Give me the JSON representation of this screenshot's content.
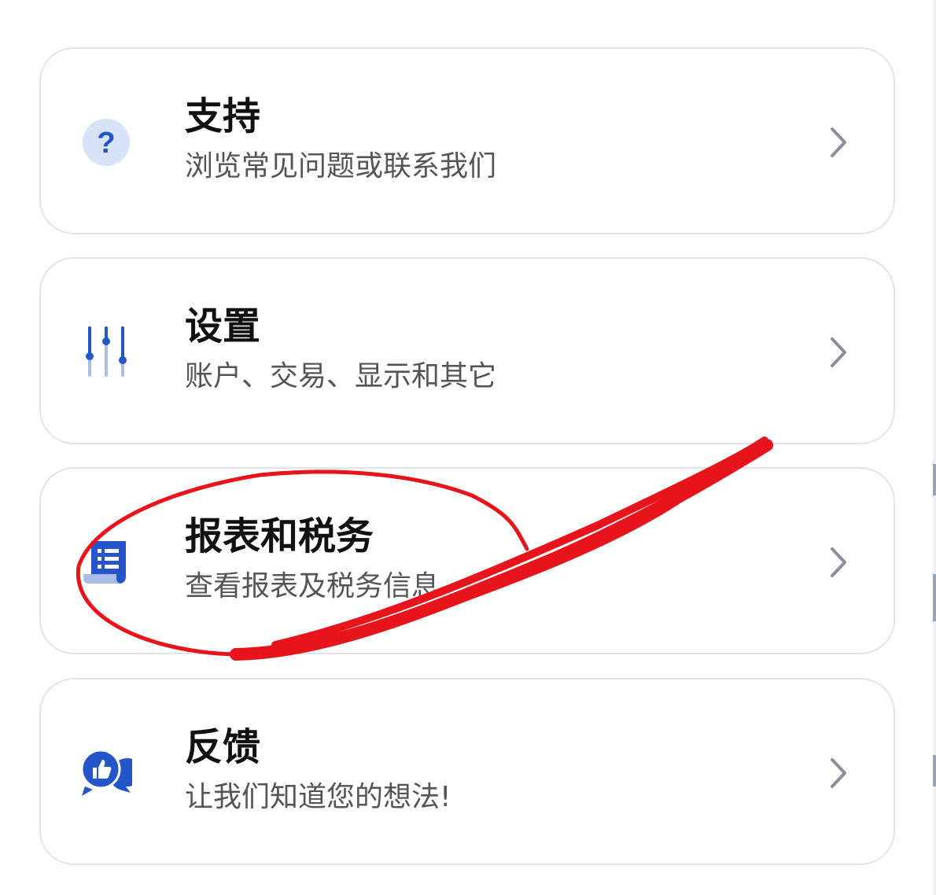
{
  "cards": [
    {
      "title": "支持",
      "subtitle": "浏览常见问题或联系我们",
      "icon": "help-question-icon"
    },
    {
      "title": "设置",
      "subtitle": "账户、交易、显示和其它",
      "icon": "sliders-settings-icon"
    },
    {
      "title": "报表和税务",
      "subtitle": "查看报表及税务信息",
      "icon": "document-list-icon"
    },
    {
      "title": "反馈",
      "subtitle": "让我们知道您的想法!",
      "icon": "feedback-chat-icon"
    }
  ],
  "colors": {
    "accent": "#2456c9",
    "accent_light": "#d6e3f8",
    "annotation": "#e8141c",
    "card_border": "#e2e4e8",
    "chevron": "#8a8f99"
  }
}
